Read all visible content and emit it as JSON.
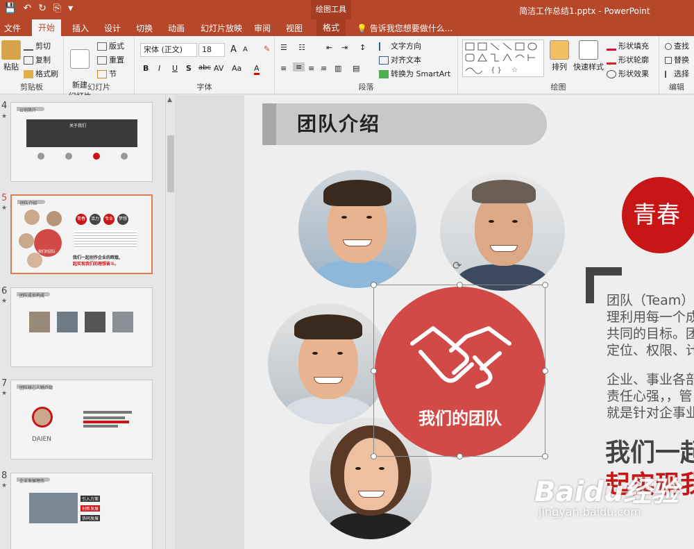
{
  "titlebar": {
    "qat_save": "💾",
    "qat_undo": "↶",
    "qat_redo": "↻",
    "qat_present": "⎘",
    "qat_more": "▾",
    "context_tools": "绘图工具",
    "document_title": "简洁工作总结1.pptx - PowerPoint"
  },
  "tabs": [
    "文件",
    "开始",
    "插入",
    "设计",
    "切换",
    "动画",
    "幻灯片放映",
    "审阅",
    "视图"
  ],
  "tab_format": "格式",
  "tell_me": "告诉我您想要做什么...",
  "ribbon": {
    "clipboard": {
      "paste": "粘贴",
      "cut": "剪切",
      "copy": "复制",
      "format_painter": "格式刷",
      "label": "剪贴板"
    },
    "slides": {
      "new_slide": "新建\n幻灯片",
      "layout": "版式",
      "reset": "重置",
      "section": "节",
      "label": "幻灯片"
    },
    "font": {
      "font_name": "宋体 (正文)",
      "font_size": "18",
      "label": "字体",
      "bold": "B",
      "italic": "I",
      "underline": "U",
      "shadow": "S",
      "strike": "abc",
      "spacing": "AV",
      "case": "Aa",
      "color": "A",
      "grow": "A",
      "shrink": "A"
    },
    "paragraph": {
      "text_direction": "文字方向",
      "align_text": "对齐文本",
      "smartart": "转换为 SmartArt",
      "label": "段落"
    },
    "drawing": {
      "arrange": "排列",
      "quick_styles": "快速样式",
      "shape_fill": "形状填充",
      "shape_outline": "形状轮廓",
      "shape_effects": "形状效果",
      "label": "绘图"
    },
    "editing": {
      "find": "查找",
      "replace": "替换",
      "select": "选择",
      "label": "编辑"
    }
  },
  "thumbnails": [
    {
      "num": "4",
      "title": "公司简介",
      "heading": "关于我们"
    },
    {
      "num": "5",
      "title": "团队介绍",
      "tags": [
        "青春",
        "活力",
        "专业",
        "梦想"
      ],
      "caption": "我们的团队",
      "line1": "我们一起创作企业的辉煌,",
      "line2": "起实现我们的理想奋斗。"
    },
    {
      "num": "6",
      "title": "团队成员构成"
    },
    {
      "num": "7",
      "title": "团队核心人物介绍",
      "name": "DAIEN"
    },
    {
      "num": "8",
      "title": "企业发展理念",
      "items": [
        "引入方案",
        "创新发展",
        "协同发展"
      ]
    }
  ],
  "slide": {
    "title": "团队介绍",
    "team_label": "我们的团队",
    "tag": "青春",
    "para1": [
      "团队（Team）",
      "理利用每一个成",
      "共同的目标。团",
      "定位、权限、计"
    ],
    "para2": [
      "企业、事业各部",
      "责任心强，，管",
      "就是针对企事业"
    ],
    "bold_black": "我们一起",
    "bold_red": "起实现我"
  },
  "watermark": {
    "main": "Baidu经验",
    "url": "jingyan.baidu.com"
  },
  "colors": {
    "accent": "#b7472a",
    "team_circle": "#d14a48",
    "tag_red": "#c81515"
  }
}
